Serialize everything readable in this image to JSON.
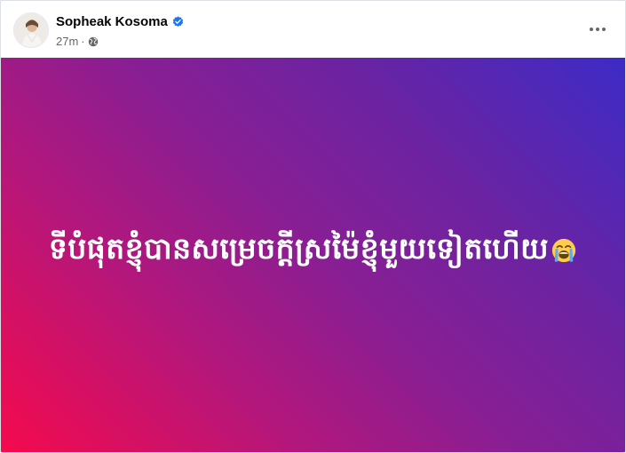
{
  "post": {
    "author": {
      "name": "Sopheak Kosoma",
      "verified": true,
      "verified_icon": "verified-badge-icon",
      "avatar_icon": "avatar"
    },
    "meta": {
      "time": "27m",
      "separator": "·",
      "privacy_icon": "globe-icon"
    },
    "more_icon": "more-options-icon",
    "content": {
      "text": "ទីបំផុតខ្ញុំបានសម្រេចក្តីស្រម៉ៃខ្ញុំមួយទៀតហើយ",
      "emoji": "😭",
      "emoji_icon": "loudly-crying-face-icon"
    },
    "colors": {
      "gradient_start": "#f50a4d",
      "gradient_end": "#3d2bc6",
      "verified_blue": "#1877f2",
      "meta_gray": "#65676b"
    }
  }
}
